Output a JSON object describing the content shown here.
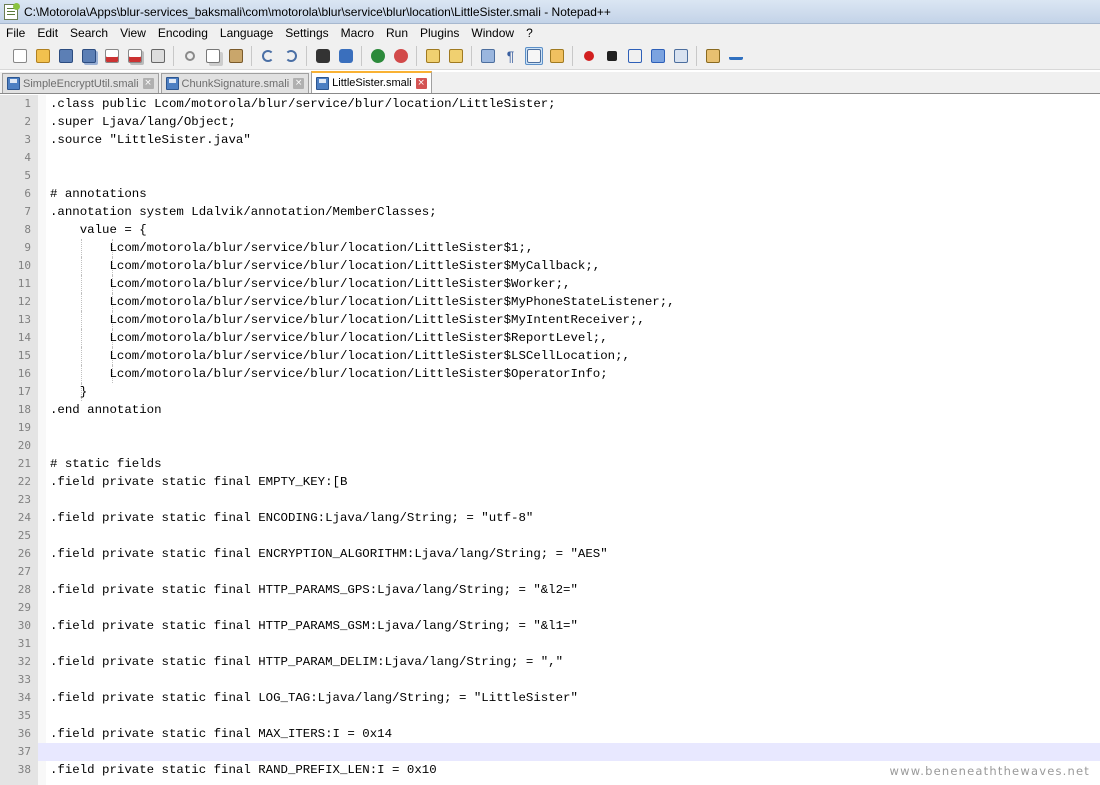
{
  "window": {
    "title": "C:\\Motorola\\Apps\\blur-services_baksmali\\com\\motorola\\blur\\service\\blur\\location\\LittleSister.smali - Notepad++"
  },
  "menu": [
    "File",
    "Edit",
    "Search",
    "View",
    "Encoding",
    "Language",
    "Settings",
    "Macro",
    "Run",
    "Plugins",
    "Window",
    "?"
  ],
  "toolbar": {
    "icons": [
      "new-file-icon",
      "open-file-icon",
      "save-icon",
      "save-all-icon",
      "close-icon",
      "close-all-icon",
      "print-icon",
      "cut-icon",
      "copy-icon",
      "paste-icon",
      "undo-icon",
      "redo-icon",
      "find-icon",
      "replace-icon",
      "zoom-in-icon",
      "zoom-out-icon",
      "sync-vertical-icon",
      "sync-horizontal-icon",
      "word-wrap-icon",
      "show-all-chars-icon",
      "indent-guide-icon",
      "function-list-icon",
      "record-macro-icon",
      "stop-record-icon",
      "play-macro-icon",
      "run-macro-multiple-icon",
      "save-macro-icon",
      "plugin-icon",
      "spell-check-icon"
    ],
    "icon_colors": {
      "new": "#ffffff",
      "open": "#f2c14e",
      "save": "#5c7fb5",
      "close": "#cc3333",
      "cut": "#8a8a8a",
      "undo": "#4a6fa5",
      "find": "#333333",
      "zoom": "#2c8a3b",
      "macro_record": "#d21f1f",
      "macro_stop": "#202020",
      "macro_play": "#2d5fb8"
    }
  },
  "tabs": [
    {
      "label": "SimpleEncryptUtil.smali",
      "active": false
    },
    {
      "label": "ChunkSignature.smali",
      "active": false
    },
    {
      "label": "LittleSister.smali",
      "active": true
    }
  ],
  "editor": {
    "current_line": 37,
    "lines": [
      {
        "n": "1",
        "text": ".class public Lcom/motorola/blur/service/blur/location/LittleSister;",
        "guides": 0
      },
      {
        "n": "2",
        "text": ".super Ljava/lang/Object;",
        "guides": 0
      },
      {
        "n": "3",
        "text": ".source \"LittleSister.java\"",
        "guides": 0
      },
      {
        "n": "4",
        "text": "",
        "guides": 0
      },
      {
        "n": "5",
        "text": "",
        "guides": 0
      },
      {
        "n": "6",
        "text": "# annotations",
        "guides": 0
      },
      {
        "n": "7",
        "text": ".annotation system Ldalvik/annotation/MemberClasses;",
        "guides": 0
      },
      {
        "n": "8",
        "text": "    value = {",
        "guides": 0
      },
      {
        "n": "9",
        "text": "        Lcom/motorola/blur/service/blur/location/LittleSister$1;,",
        "guides": 2
      },
      {
        "n": "10",
        "text": "        Lcom/motorola/blur/service/blur/location/LittleSister$MyCallback;,",
        "guides": 2
      },
      {
        "n": "11",
        "text": "        Lcom/motorola/blur/service/blur/location/LittleSister$Worker;,",
        "guides": 2
      },
      {
        "n": "12",
        "text": "        Lcom/motorola/blur/service/blur/location/LittleSister$MyPhoneStateListener;,",
        "guides": 2
      },
      {
        "n": "13",
        "text": "        Lcom/motorola/blur/service/blur/location/LittleSister$MyIntentReceiver;,",
        "guides": 2
      },
      {
        "n": "14",
        "text": "        Lcom/motorola/blur/service/blur/location/LittleSister$ReportLevel;,",
        "guides": 2
      },
      {
        "n": "15",
        "text": "        Lcom/motorola/blur/service/blur/location/LittleSister$LSCellLocation;,",
        "guides": 2
      },
      {
        "n": "16",
        "text": "        Lcom/motorola/blur/service/blur/location/LittleSister$OperatorInfo;",
        "guides": 2
      },
      {
        "n": "17",
        "text": "    }",
        "guides": 1
      },
      {
        "n": "18",
        "text": ".end annotation",
        "guides": 0
      },
      {
        "n": "19",
        "text": "",
        "guides": 0
      },
      {
        "n": "20",
        "text": "",
        "guides": 0
      },
      {
        "n": "21",
        "text": "# static fields",
        "guides": 0
      },
      {
        "n": "22",
        "text": ".field private static final EMPTY_KEY:[B",
        "guides": 0
      },
      {
        "n": "23",
        "text": "",
        "guides": 0
      },
      {
        "n": "24",
        "text": ".field private static final ENCODING:Ljava/lang/String; = \"utf-8\"",
        "guides": 0
      },
      {
        "n": "25",
        "text": "",
        "guides": 0
      },
      {
        "n": "26",
        "text": ".field private static final ENCRYPTION_ALGORITHM:Ljava/lang/String; = \"AES\"",
        "guides": 0
      },
      {
        "n": "27",
        "text": "",
        "guides": 0
      },
      {
        "n": "28",
        "text": ".field private static final HTTP_PARAMS_GPS:Ljava/lang/String; = \"&l2=\"",
        "guides": 0
      },
      {
        "n": "29",
        "text": "",
        "guides": 0
      },
      {
        "n": "30",
        "text": ".field private static final HTTP_PARAMS_GSM:Ljava/lang/String; = \"&l1=\"",
        "guides": 0
      },
      {
        "n": "31",
        "text": "",
        "guides": 0
      },
      {
        "n": "32",
        "text": ".field private static final HTTP_PARAM_DELIM:Ljava/lang/String; = \",\"",
        "guides": 0
      },
      {
        "n": "33",
        "text": "",
        "guides": 0
      },
      {
        "n": "34",
        "text": ".field private static final LOG_TAG:Ljava/lang/String; = \"LittleSister\"",
        "guides": 0
      },
      {
        "n": "35",
        "text": "",
        "guides": 0
      },
      {
        "n": "36",
        "text": ".field private static final MAX_ITERS:I = 0x14",
        "guides": 0
      },
      {
        "n": "37",
        "text": "",
        "guides": 0
      },
      {
        "n": "38",
        "text": ".field private static final RAND_PREFIX_LEN:I = 0x10",
        "guides": 0
      }
    ]
  },
  "watermark": "www.beneneaththewaves.net"
}
